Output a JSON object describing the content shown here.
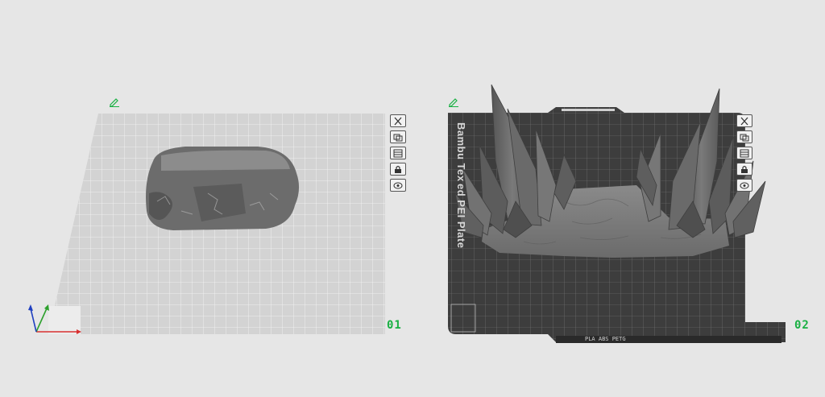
{
  "plates": [
    {
      "number": "01",
      "type": "plain"
    },
    {
      "number": "02",
      "type": "textured"
    }
  ],
  "plate2": {
    "brand_text_top": "Bambu Tex",
    "brand_text_bottom": "ed PEI Plate",
    "footer_label": "PLA ABS PETG"
  },
  "icons": {
    "edit": "pencil-icon",
    "tools": [
      "close-icon",
      "arrange-icon",
      "layers-icon",
      "lock-icon",
      "settings-icon"
    ]
  },
  "colors": {
    "background": "#e6e6e6",
    "plate_light": "#d2d2d2",
    "plate_dark": "#3d3d3d",
    "accent_green": "#19b043",
    "axis_x": "#d83030",
    "axis_y": "#2ca02c",
    "axis_z": "#2040c0",
    "model_gray": "#6f6f6f"
  }
}
